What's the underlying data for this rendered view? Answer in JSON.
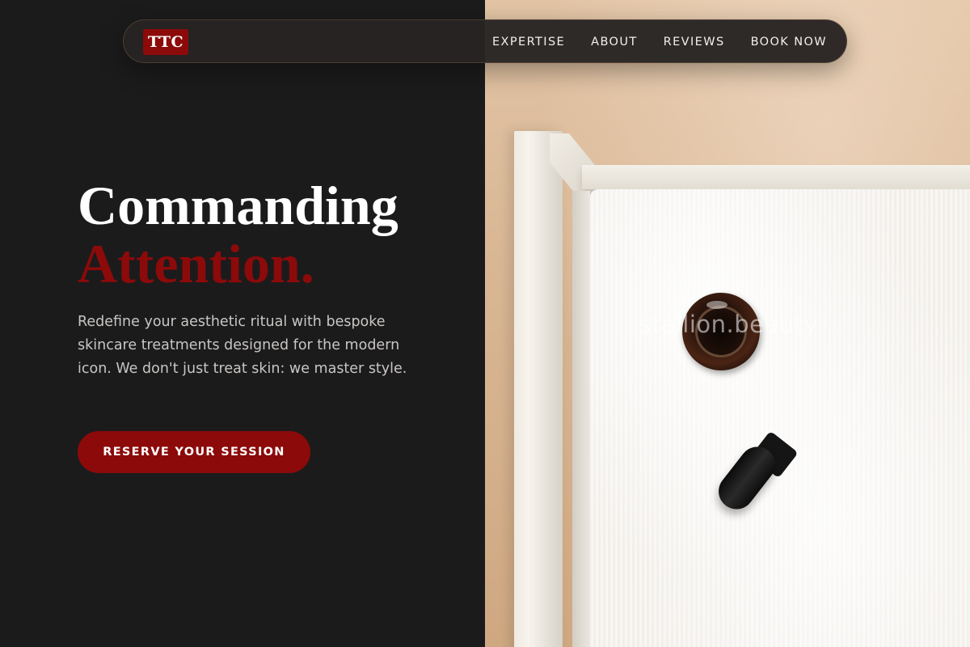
{
  "brand": {
    "logo_text": "TTC",
    "accent_color": "#8c0a0a"
  },
  "nav": {
    "items": [
      {
        "label": "EXPERTISE"
      },
      {
        "label": "ABOUT"
      },
      {
        "label": "REVIEWS"
      },
      {
        "label": "BOOK NOW"
      }
    ]
  },
  "hero": {
    "title_line1": "Commanding",
    "title_line2": "Attention.",
    "description": "Redefine your aesthetic ritual with bespoke skincare treatments designed for the modern icon. We don't just treat skin: we master style.",
    "cta_label": "RESERVE YOUR SESSION"
  },
  "image": {
    "watermark": "stallion.beauty"
  }
}
